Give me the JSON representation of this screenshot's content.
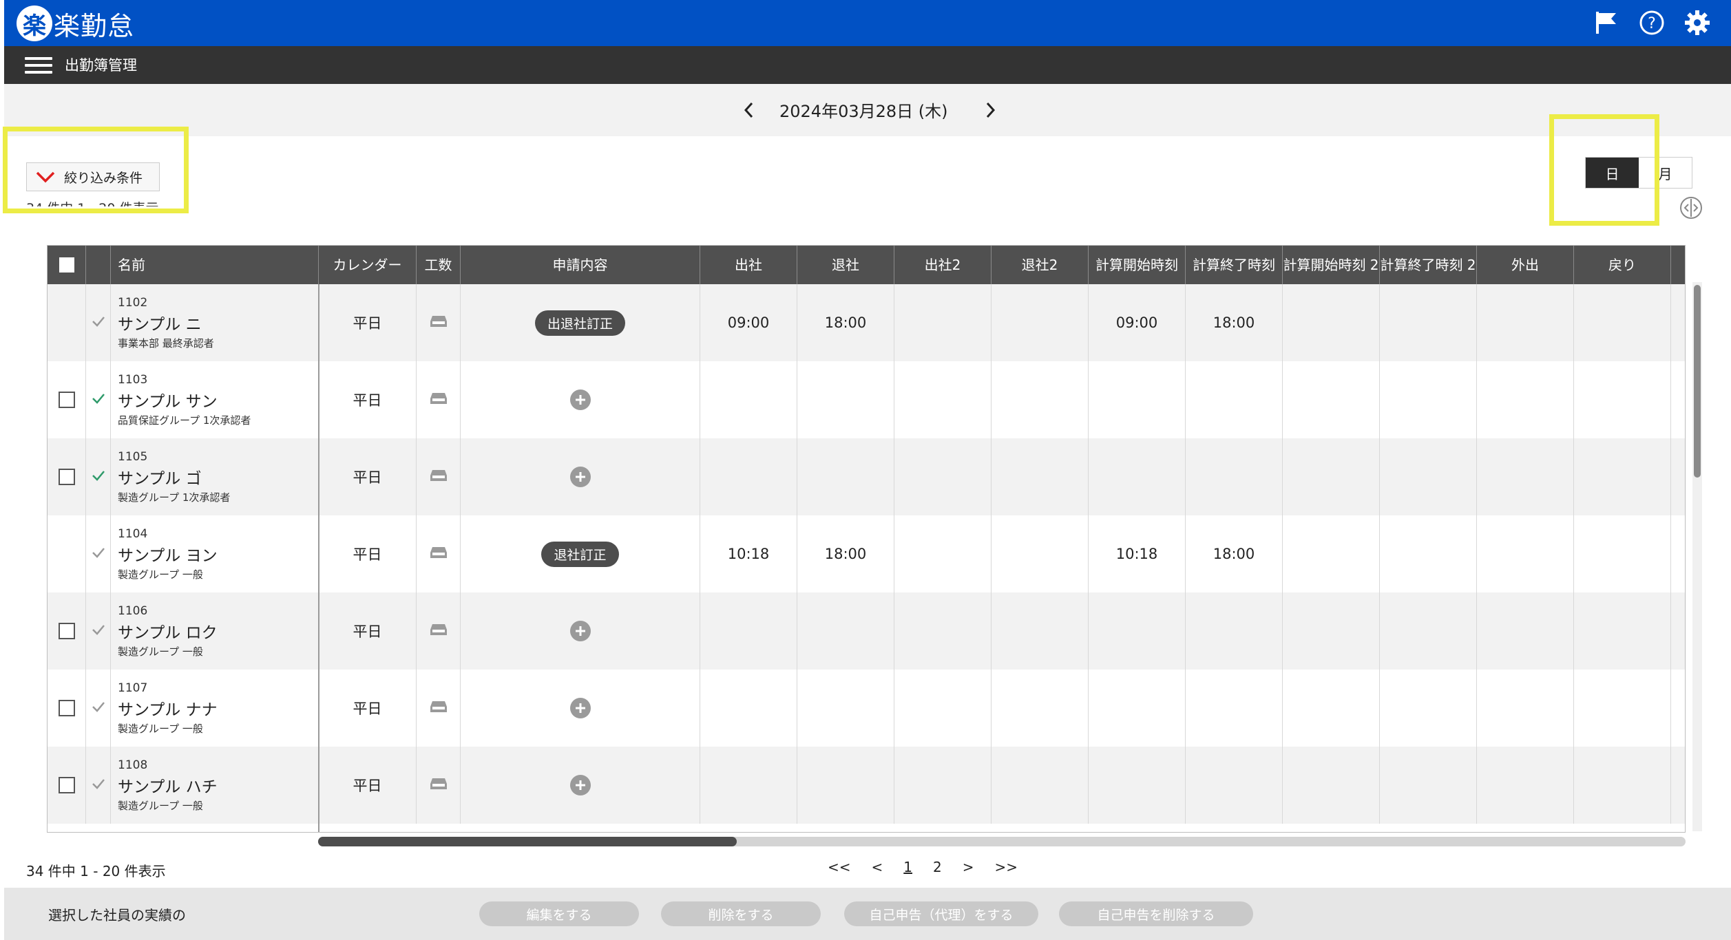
{
  "app": {
    "logo_char": "楽",
    "logo_text": "楽勤怠"
  },
  "nav": {
    "title": "出勤簿管理"
  },
  "date": {
    "text": "2024年03月28日 (木)"
  },
  "filter": {
    "label": "絞り込み条件",
    "count_text": "34 件中 1 - 20 件表示"
  },
  "view_toggle": {
    "day": "日",
    "month": "月",
    "active": "日"
  },
  "table": {
    "headers": {
      "name": "名前",
      "calendar": "カレンダー",
      "kousu": "工数",
      "request": "申請内容",
      "in": "出社",
      "out": "退社",
      "in2": "出社2",
      "out2": "退社2",
      "calc_start": "計算開始時刻",
      "calc_end": "計算終了時刻",
      "calc_start2": "計算開始時刻 2",
      "calc_end2": "計算終了時刻 2",
      "goout": "外出",
      "back": "戻り"
    },
    "rows": [
      {
        "code": "1102",
        "name": "サンプル ニ",
        "dept": "事業本部 最終承認者",
        "calendar": "平日",
        "request": "出退社訂正",
        "in": "09:00",
        "out": "18:00",
        "calc_start": "09:00",
        "calc_end": "18:00"
      },
      {
        "code": "1103",
        "name": "サンプル サン",
        "dept": "品質保証グループ 1次承認者",
        "calendar": "平日",
        "request": "",
        "in": "",
        "out": "",
        "calc_start": "",
        "calc_end": ""
      },
      {
        "code": "1105",
        "name": "サンプル ゴ",
        "dept": "製造グループ 1次承認者",
        "calendar": "平日",
        "request": "",
        "in": "",
        "out": "",
        "calc_start": "",
        "calc_end": ""
      },
      {
        "code": "1104",
        "name": "サンプル ヨン",
        "dept": "製造グループ 一般",
        "calendar": "平日",
        "request": "退社訂正",
        "in": "10:18",
        "out": "18:00",
        "calc_start": "10:18",
        "calc_end": "18:00"
      },
      {
        "code": "1106",
        "name": "サンプル ロク",
        "dept": "製造グループ 一般",
        "calendar": "平日",
        "request": "",
        "in": "",
        "out": "",
        "calc_start": "",
        "calc_end": ""
      },
      {
        "code": "1107",
        "name": "サンプル ナナ",
        "dept": "製造グループ 一般",
        "calendar": "平日",
        "request": "",
        "in": "",
        "out": "",
        "calc_start": "",
        "calc_end": ""
      },
      {
        "code": "1108",
        "name": "サンプル ハチ",
        "dept": "製造グループ 一般",
        "calendar": "平日",
        "request": "",
        "in": "",
        "out": "",
        "calc_start": "",
        "calc_end": ""
      }
    ]
  },
  "pagination": {
    "first": "<<",
    "prev": "<",
    "page1": "1",
    "page2": "2",
    "next": ">",
    "last": ">>"
  },
  "footer": {
    "label": "選択した社員の実績の",
    "edit": "編集をする",
    "delete": "削除をする",
    "self_report": "自己申告（代理）をする",
    "delete_self_report": "自己申告を削除する"
  },
  "colors": {
    "brand": "#0151c4",
    "check_approved": "#2e9a6a",
    "check_pending": "#999999",
    "highlight": "#ecec46"
  }
}
